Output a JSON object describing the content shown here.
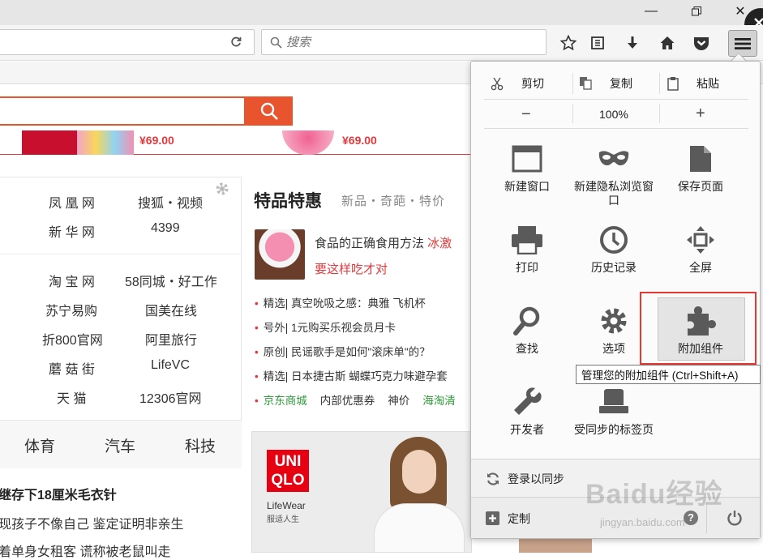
{
  "search": {
    "placeholder": "搜索"
  },
  "content": {
    "promo_prices": [
      "¥69.00",
      "¥69.00"
    ],
    "sites": [
      [
        "凤 凰 网",
        "搜狐・视频"
      ],
      [
        "新 华 网",
        "4399"
      ],
      [
        "淘 宝 网",
        "58同城・好工作"
      ],
      [
        "苏宁易购",
        "国美在线"
      ],
      [
        "折800官网",
        "阿里旅行"
      ],
      [
        "蘑 菇 街",
        "LifeVC"
      ],
      [
        "天 猫",
        "12306官网"
      ]
    ],
    "special_title": "特品特惠",
    "special_sub": "新品・奇葩・特价",
    "feature_title_a": "食品的正确食用方法 ",
    "feature_title_b": "冰激",
    "feature_sub": "要这样吃才对",
    "news": [
      "精选| 真空吮吸之感：典雅 飞机杯",
      "号外| 1元购买乐视会员月卡",
      "原创| 民谣歌手是如何\"滚床单\"的？",
      "精选| 日本捷古斯 蝴蝶巧克力味避孕套"
    ],
    "links": [
      "京东商城",
      "内部优惠券",
      "神价",
      "海淘清"
    ],
    "tabs": [
      "体育",
      "汽车",
      "科技"
    ],
    "headlines": [
      "继存下18厘米毛衣针",
      "现孩子不像自己 鉴定证明非亲生",
      "着单身女租客 谎称被老鼠叫走"
    ],
    "ad_brand": [
      "UNI",
      "QLO"
    ],
    "ad_tag": "LifeWear",
    "ad_tag2": "服适人生"
  },
  "menu": {
    "cut": "剪切",
    "copy": "复制",
    "paste": "粘贴",
    "zoom_out": "−",
    "zoom": "100%",
    "zoom_in": "+",
    "items": [
      {
        "label": "新建窗口",
        "icon": "new-window-icon"
      },
      {
        "label": "新建隐私浏览窗口",
        "icon": "private-mask-icon"
      },
      {
        "label": "保存页面",
        "icon": "save-page-icon"
      },
      {
        "label": "打印",
        "icon": "printer-icon"
      },
      {
        "label": "历史记录",
        "icon": "history-clock-icon"
      },
      {
        "label": "全屏",
        "icon": "fullscreen-icon"
      },
      {
        "label": "查找",
        "icon": "find-icon"
      },
      {
        "label": "选项",
        "icon": "gear-icon"
      },
      {
        "label": "附加组件",
        "icon": "puzzle-icon"
      },
      {
        "label": "开发者",
        "icon": "wrench-icon"
      },
      {
        "label": "受同步的标签页",
        "icon": "synced-tabs-icon"
      }
    ],
    "sync": "登录以同步",
    "customize": "定制",
    "tooltip": "管理您的附加组件 (Ctrl+Shift+A)"
  },
  "watermark": {
    "brand": "Baidu经验",
    "url": "jingyan.baidu.com"
  }
}
